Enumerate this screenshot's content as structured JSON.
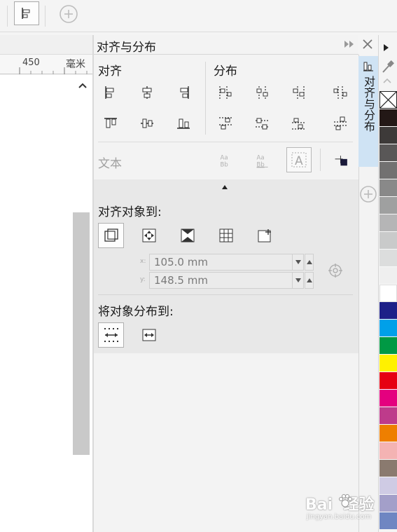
{
  "ruler": {
    "mark": "450",
    "unit": "毫米"
  },
  "panel": {
    "title": "对齐与分布",
    "align_label": "对齐",
    "distribute_label": "分布",
    "text_label": "文本",
    "align_to_label": "对齐对象到:",
    "distribute_to_label": "将对象分布到:",
    "x_label": "x:",
    "x_value": "105.0 mm",
    "y_label": "y:",
    "y_value": "148.5 mm"
  },
  "side_tab": {
    "label": "对齐与分布"
  },
  "watermark": {
    "text": "Bai  经验",
    "sub": "jingyan.baidu.com"
  },
  "palette": {
    "colors": [
      "#231816",
      "#3d3a39",
      "#595757",
      "#727171",
      "#898989",
      "#9fa0a0",
      "#b5b5b6",
      "#c9caca",
      "#dcdddd",
      "#efefef",
      "#ffffff",
      "#1d2088",
      "#00a0e9",
      "#009944",
      "#fff100",
      "#e60012",
      "#e4007f",
      "#be3b8b",
      "#ee7f00",
      "#f4b3b3",
      "#8a7a6f",
      "#cfcbe4",
      "#a39fc9",
      "#6f86c2"
    ]
  }
}
